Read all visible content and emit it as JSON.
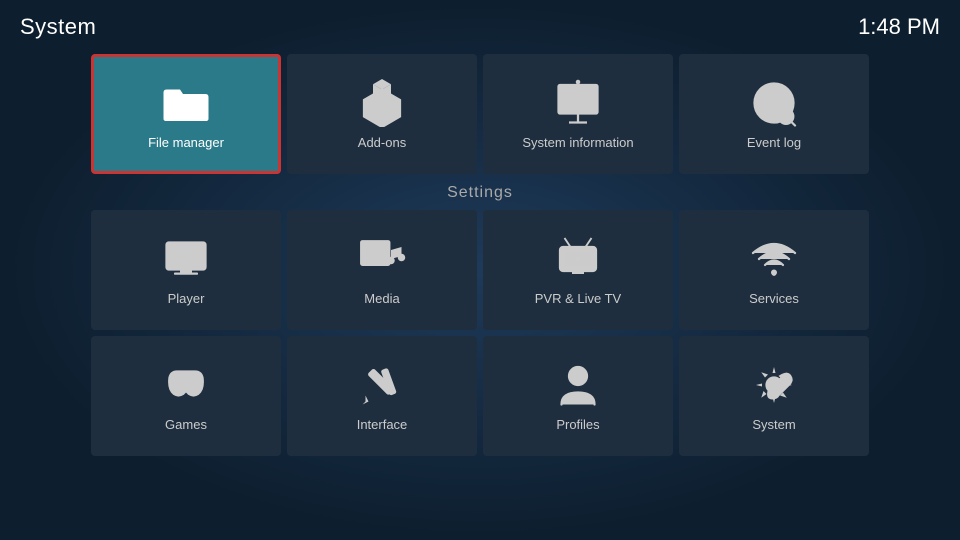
{
  "header": {
    "title": "System",
    "time": "1:48 PM"
  },
  "top_tiles": [
    {
      "id": "file-manager",
      "label": "File manager",
      "active": true
    },
    {
      "id": "add-ons",
      "label": "Add-ons",
      "active": false
    },
    {
      "id": "system-information",
      "label": "System information",
      "active": false
    },
    {
      "id": "event-log",
      "label": "Event log",
      "active": false
    }
  ],
  "settings_label": "Settings",
  "settings_row1": [
    {
      "id": "player",
      "label": "Player"
    },
    {
      "id": "media",
      "label": "Media"
    },
    {
      "id": "pvr-live-tv",
      "label": "PVR & Live TV"
    },
    {
      "id": "services",
      "label": "Services"
    }
  ],
  "settings_row2": [
    {
      "id": "games",
      "label": "Games"
    },
    {
      "id": "interface",
      "label": "Interface"
    },
    {
      "id": "profiles",
      "label": "Profiles"
    },
    {
      "id": "system",
      "label": "System"
    }
  ]
}
